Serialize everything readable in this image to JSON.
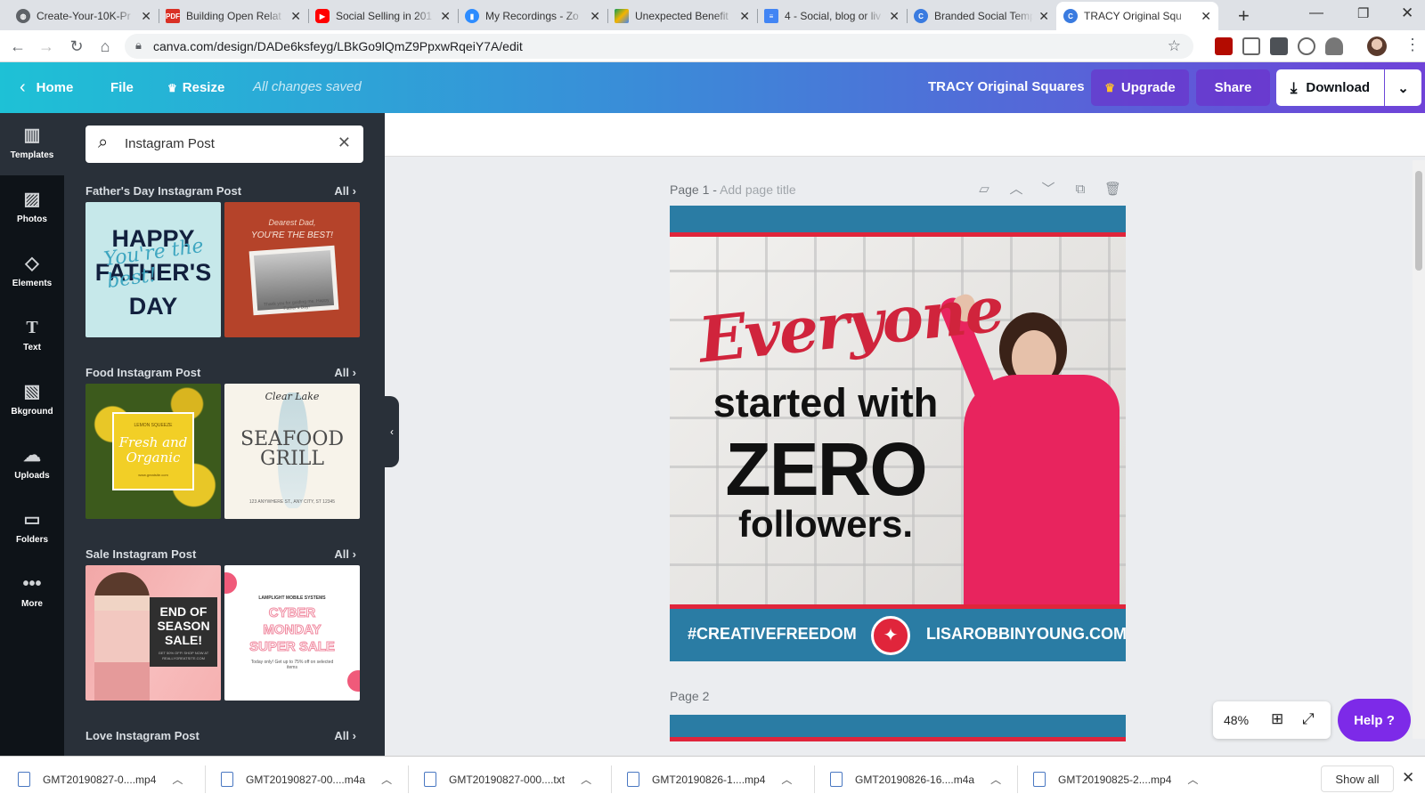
{
  "browser": {
    "tabs": [
      {
        "title": "Create-Your-10K-Pr",
        "icon": "globe-icon"
      },
      {
        "title": "Building Open Relat",
        "icon": "pdf-icon"
      },
      {
        "title": "Social Selling in 201",
        "icon": "youtube-icon"
      },
      {
        "title": "My Recordings - Zo",
        "icon": "zoom-icon"
      },
      {
        "title": "Unexpected Benefit",
        "icon": "drive-icon"
      },
      {
        "title": "4 - Social, blog or liv",
        "icon": "docs-icon"
      },
      {
        "title": "Branded Social Temp",
        "icon": "canva-icon"
      },
      {
        "title": "TRACY Original Squ",
        "icon": "canva-icon"
      }
    ],
    "new_tab": "+",
    "url": "canva.com/design/DADe6ksfeyg/LBkGo9lQmZ9PpxwRqeiY7A/edit"
  },
  "header": {
    "home": "Home",
    "file": "File",
    "resize": "Resize",
    "saved": "All changes saved",
    "doc_title": "TRACY Original Squares",
    "upgrade": "Upgrade",
    "share": "Share",
    "download": "Download"
  },
  "rail": [
    {
      "label": "Templates",
      "icon": "templates-icon"
    },
    {
      "label": "Photos",
      "icon": "photos-icon"
    },
    {
      "label": "Elements",
      "icon": "elements-icon"
    },
    {
      "label": "Text",
      "icon": "text-icon"
    },
    {
      "label": "Bkground",
      "icon": "background-icon"
    },
    {
      "label": "Uploads",
      "icon": "uploads-icon"
    },
    {
      "label": "Folders",
      "icon": "folders-icon"
    },
    {
      "label": "More",
      "icon": "more-icon"
    }
  ],
  "panel": {
    "search_value": "Instagram Post",
    "sections": [
      {
        "title": "Father's Day Instagram Post",
        "all": "All"
      },
      {
        "title": "Food Instagram Post",
        "all": "All"
      },
      {
        "title": "Sale Instagram Post",
        "all": "All"
      },
      {
        "title": "Love Instagram Post",
        "all": "All"
      }
    ],
    "thumbs": {
      "fathers1": {
        "l1": "HAPPY",
        "l2": "FATHER'S",
        "l3": "DAY",
        "script": "You're the best!"
      },
      "fathers2": {
        "l1": "Dearest Dad,",
        "l2": "YOU'RE THE BEST!",
        "l3": "Thank you for guiding me. Happy Father's Day!"
      },
      "food1": {
        "l1": "LEMON SQUEEZE",
        "l2": "Fresh and Organic",
        "l3": "www.greatsite.com"
      },
      "food2": {
        "l1": "Clear Lake",
        "l2": "SEAFOOD",
        "l3": "GRILL",
        "l4": "123 ANYWHERE ST., ANY CITY, ST 12345"
      },
      "sale1": {
        "l1": "END OF",
        "l2": "SEASON",
        "l3": "SALE!",
        "l4": "GET 50% OFF! SHOP NOW AT REALLYGREATSITE.COM"
      },
      "sale2": {
        "l1": "LAMPLIGHT MOBILE SYSTEMS",
        "l2": "CYBER",
        "l3": "MONDAY",
        "l4": "SUPER SALE",
        "l5": "Today only! Get up to 75% off on selected items"
      }
    }
  },
  "canvas": {
    "page1_label": "Page 1 -",
    "page1_placeholder": "Add page title",
    "page2_label": "Page 2",
    "design": {
      "script": "Everyone",
      "line2": "started with",
      "line3": "ZERO",
      "line4": "followers.",
      "hashtag": "#CREATIVEFREEDOM",
      "site": "LISAROBBINYOUNG.COM"
    },
    "zoom": "48%",
    "help": "Help ?"
  },
  "downloads": {
    "items": [
      "GMT20190827-0....mp4",
      "GMT20190827-00....m4a",
      "GMT20190827-000....txt",
      "GMT20190826-1....mp4",
      "GMT20190826-16....m4a",
      "GMT20190825-2....mp4"
    ],
    "show_all": "Show all"
  },
  "colors": {
    "canva_purple": "#7d2ae8",
    "design_blue": "#2a7ca4",
    "design_red": "#e0253b",
    "shirt_pink": "#e8245e"
  }
}
